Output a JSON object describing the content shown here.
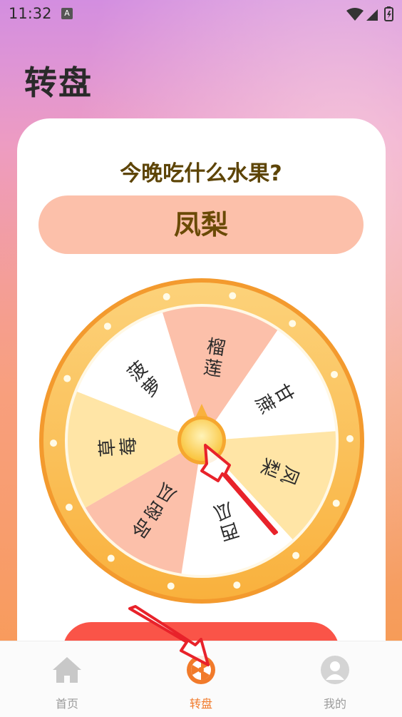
{
  "status_bar": {
    "time": "11:32",
    "notification_badge": "A",
    "icons": [
      "wifi-icon",
      "signal-icon",
      "battery-icon"
    ]
  },
  "page_title": "转盘",
  "question": "今晚吃什么水果?",
  "result": "凤梨",
  "wheel": {
    "segments": [
      {
        "label": "榴莲",
        "color": "#fcc0aa"
      },
      {
        "label": "甘蔗",
        "color": "#ffffff"
      },
      {
        "label": "凤梨",
        "color": "#ffe5a6"
      },
      {
        "label": "西瓜",
        "color": "#ffffff"
      },
      {
        "label": "哈密瓜",
        "color": "#fcc0aa"
      },
      {
        "label": "草莓",
        "color": "#ffe5a6"
      },
      {
        "label": "菠萝",
        "color": "#ffffff"
      }
    ],
    "rim_color": "#fbb03b",
    "hub_color": "#fdd25b"
  },
  "tabs": [
    {
      "label": "首页",
      "icon": "home-icon",
      "active": false
    },
    {
      "label": "转盘",
      "icon": "wheel-icon",
      "active": true
    },
    {
      "label": "我的",
      "icon": "user-icon",
      "active": false
    }
  ],
  "colors": {
    "accent": "#f17a2a",
    "button": "#fa5448",
    "annotation_arrow": "#e8222a"
  }
}
